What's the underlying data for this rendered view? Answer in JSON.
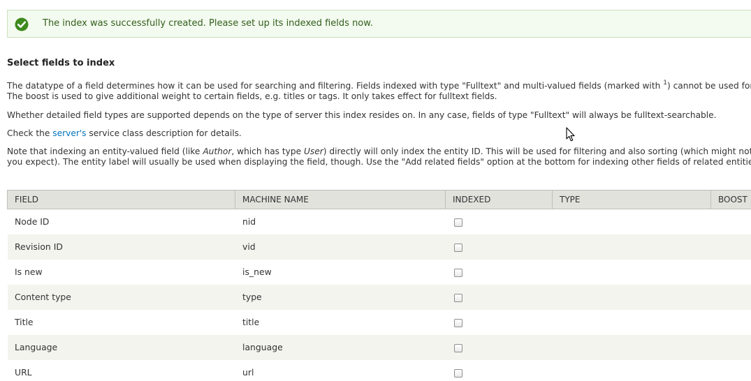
{
  "status": {
    "message": "The index was successfully created. Please set up its indexed fields now.",
    "icon": "check-circle-icon",
    "color": "#325e1c"
  },
  "section": {
    "title": "Select fields to index"
  },
  "description": {
    "p1_line1_a": "The datatype of a field determines how it can be used for searching and filtering. Fields indexed with type \"Fulltext\" and multi-valued fields (marked with ",
    "p1_sup": "1",
    "p1_line1_b": ") cannot be used for",
    "p1_line2": "The boost is used to give additional weight to certain fields, e.g. titles or tags. It only takes effect for fulltext fields.",
    "p2": "Whether detailed field types are supported depends on the type of server this index resides on. In any case, fields of type \"Fulltext\" will always be fulltext-searchable.",
    "p3_a": "Check the ",
    "p3_link": "server's",
    "p3_b": " service class description for details.",
    "p4_line1_a": "Note that indexing an entity-valued field (like ",
    "p4_author": "Author",
    "p4_line1_b": ", which has type ",
    "p4_user": "User",
    "p4_line1_c": ") directly will only index the entity ID. This will be used for filtering and also sorting (which might not",
    "p4_line2": "you expect). The entity label will usually be used when displaying the field, though. Use the \"Add related fields\" option at the bottom for indexing other fields of related entities"
  },
  "table": {
    "headers": {
      "field": "FIELD",
      "machine_name": "MACHINE NAME",
      "indexed": "INDEXED",
      "type": "TYPE",
      "boost": "BOOST"
    },
    "rows": [
      {
        "field": "Node ID",
        "machine_name": "nid"
      },
      {
        "field": "Revision ID",
        "machine_name": "vid"
      },
      {
        "field": "Is new",
        "machine_name": "is_new"
      },
      {
        "field": "Content type",
        "machine_name": "type"
      },
      {
        "field": "Title",
        "machine_name": "title"
      },
      {
        "field": "Language",
        "machine_name": "language"
      },
      {
        "field": "URL",
        "machine_name": "url"
      }
    ]
  },
  "colors": {
    "link": "#0074bd",
    "status_bg": "#f3faef",
    "header_bg": "#e1e2dc"
  }
}
